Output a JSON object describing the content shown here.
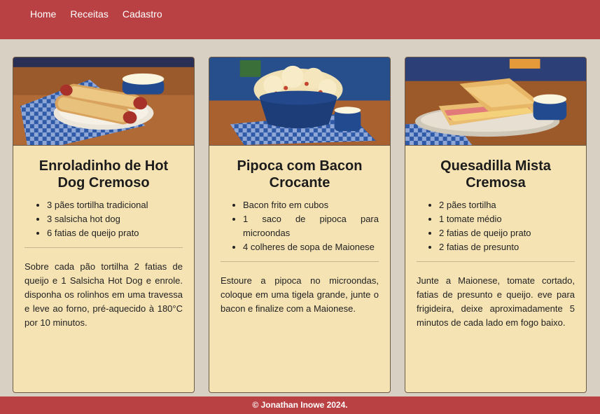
{
  "nav": {
    "items": [
      {
        "label": "Home"
      },
      {
        "label": "Receitas"
      },
      {
        "label": "Cadastro"
      }
    ]
  },
  "recipes": [
    {
      "title": "Enroladinho de Hot Dog Cremoso",
      "image": "hot-dog-rolls-photo",
      "ingredients": [
        "3 pães tortilha tradicional",
        "3 salsicha hot dog",
        "6 fatias de queijo prato"
      ],
      "instructions": "Sobre cada pão tortilha 2 fatias de queijo e 1 Salsicha Hot Dog e enrole. disponha os rolinhos em uma travessa e leve ao forno, pré-aquecido à 180°C por 10 minutos."
    },
    {
      "title": "Pipoca com Bacon Crocante",
      "image": "popcorn-bowl-photo",
      "ingredients": [
        "Bacon frito em cubos",
        "1 saco de pipoca para microondas",
        "4 colheres de sopa de Maionese"
      ],
      "instructions": "Estoure a pipoca no microondas, coloque em uma tigela grande, junte o bacon e finalize com a Maionese."
    },
    {
      "title": "Quesadilla Mista Cremosa",
      "image": "quesadilla-photo",
      "ingredients": [
        "2 pães tortilha",
        "1 tomate médio",
        "2 fatias de queijo prato",
        "2 fatias de presunto"
      ],
      "instructions": "Junte a Maionese, tomate cortado, fatias de presunto e queijo. eve para frigideira, deixe aproximadamente 5 minutos de cada lado em fogo baixo."
    }
  ],
  "footer": {
    "text": "© Jonathan Inowe 2024."
  },
  "colors": {
    "nav_bg": "#b94043",
    "page_bg": "#d9d0c4",
    "card_bg": "#f6e3b4",
    "checkered_blue": "#2f5aa8"
  }
}
